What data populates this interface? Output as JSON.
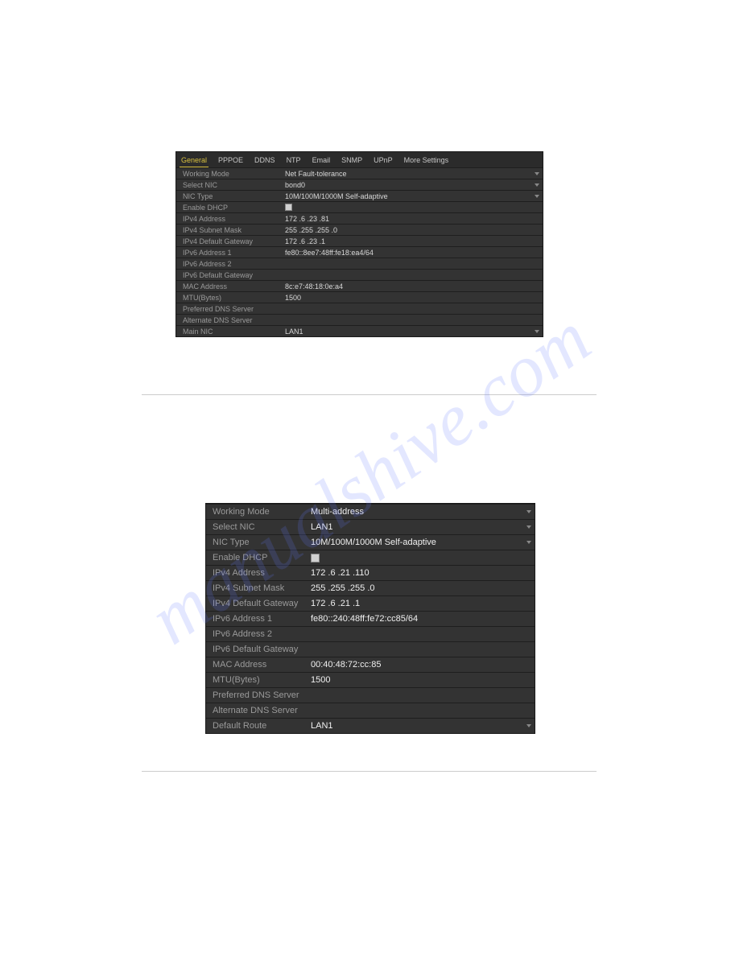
{
  "watermark": "manualshive.com",
  "panel1": {
    "tabs": [
      "General",
      "PPPOE",
      "DDNS",
      "NTP",
      "Email",
      "SNMP",
      "UPnP",
      "More Settings"
    ],
    "activeTab": 0,
    "rows": [
      {
        "label": "Working Mode",
        "value": "Net Fault-tolerance",
        "dropdown": true
      },
      {
        "label": "Select NIC",
        "value": "bond0",
        "dropdown": true
      },
      {
        "label": "NIC Type",
        "value": "10M/100M/1000M Self-adaptive",
        "dropdown": true
      },
      {
        "label": "Enable DHCP",
        "checkbox": true
      },
      {
        "label": "IPv4 Address",
        "value": "172 .6   .23  .81"
      },
      {
        "label": "IPv4 Subnet Mask",
        "value": "255 .255 .255 .0"
      },
      {
        "label": "IPv4 Default Gateway",
        "value": "172 .6   .23  .1"
      },
      {
        "label": "IPv6 Address 1",
        "value": "fe80::8ee7:48ff:fe18:ea4/64"
      },
      {
        "label": "IPv6 Address 2",
        "value": ""
      },
      {
        "label": "IPv6 Default Gateway",
        "value": ""
      },
      {
        "label": "MAC Address",
        "value": "8c:e7:48:18:0e:a4"
      },
      {
        "label": "MTU(Bytes)",
        "value": "1500"
      },
      {
        "label": "Preferred DNS Server",
        "value": ""
      },
      {
        "label": "Alternate DNS Server",
        "value": ""
      },
      {
        "label": "Main NIC",
        "value": "LAN1",
        "dropdown": true
      }
    ]
  },
  "panel2": {
    "rows": [
      {
        "label": "Working Mode",
        "value": "Multi-address",
        "dropdown": true,
        "bright": true
      },
      {
        "label": "Select NIC",
        "value": "LAN1",
        "dropdown": true,
        "bright": true
      },
      {
        "label": "NIC Type",
        "value": "10M/100M/1000M Self-adaptive",
        "dropdown": true,
        "bright": true
      },
      {
        "label": "Enable DHCP",
        "checkbox": true
      },
      {
        "label": "IPv4 Address",
        "value": "172 .6   .21  .110",
        "bright": true
      },
      {
        "label": "IPv4 Subnet Mask",
        "value": "255 .255 .255 .0",
        "bright": true
      },
      {
        "label": "IPv4 Default Gateway",
        "value": "172 .6   .21  .1",
        "bright": true
      },
      {
        "label": "IPv6 Address 1",
        "value": "fe80::240:48ff:fe72:cc85/64",
        "bright": true
      },
      {
        "label": "IPv6 Address 2",
        "value": ""
      },
      {
        "label": "IPv6 Default Gateway",
        "value": ""
      },
      {
        "label": "MAC Address",
        "value": "00:40:48:72:cc:85",
        "bright": true
      },
      {
        "label": "MTU(Bytes)",
        "value": "1500",
        "bright": true
      },
      {
        "label": "Preferred DNS Server",
        "value": ""
      },
      {
        "label": "Alternate DNS Server",
        "value": ""
      },
      {
        "label": "Default Route",
        "value": "LAN1",
        "dropdown": true,
        "bright": true
      }
    ]
  }
}
